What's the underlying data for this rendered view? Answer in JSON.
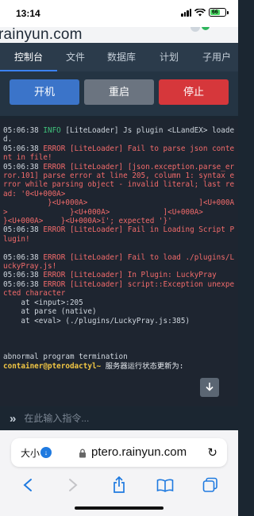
{
  "status_bar": {
    "time": "13:14",
    "battery": "66"
  },
  "header": {
    "brand": "rainyun.com"
  },
  "tabs": [
    "控制台",
    "文件",
    "数据库",
    "计划",
    "子用户"
  ],
  "controls": {
    "start": "开机",
    "restart": "重启",
    "stop": "停止"
  },
  "console": {
    "lines": [
      {
        "ts": "05:06:38 ",
        "level": "INFO",
        "msg": " [LiteLoader] Js plugin <LLandEX> loaded.",
        "type": "info"
      },
      {
        "ts": "05:06:38 ",
        "level": "ERROR",
        "msg": " [LiteLoader] Fail to parse json content in file!",
        "type": "error"
      },
      {
        "ts": "05:06:38 ",
        "level": "ERROR",
        "msg": " [LiteLoader] [json.exception.parse_error.101] parse error at line 205, column 1: syntax error while parsing object - invalid literal; last read: '0<U+000A>",
        "type": "error"
      },
      {
        "text": "          }<U+000A>                         ]<U+000A>              }<U+000A>            ]<U+000A>        }<U+000A>    }<U+000A>ï'; expected '}'",
        "type": "cont"
      },
      {
        "ts": "05:06:38 ",
        "level": "ERROR",
        "msg": " [LiteLoader] Fail in Loading Script Plugin!",
        "type": "error"
      },
      {
        "type": "blank"
      },
      {
        "ts": "05:06:38 ",
        "level": "ERROR",
        "msg": " [LiteLoader] Fail to load ./plugins/LuckyPray.js!",
        "type": "error"
      },
      {
        "ts": "05:06:38 ",
        "level": "ERROR",
        "msg": " [LiteLoader] In Plugin: LuckyPray",
        "type": "error"
      },
      {
        "ts": "05:06:38 ",
        "level": "ERROR",
        "msg": " [LiteLoader] script::Exception unexpected character",
        "type": "error"
      },
      {
        "text": "    at <input>:205",
        "type": "plain"
      },
      {
        "text": "    at parse (native)",
        "type": "plain"
      },
      {
        "text": "    at <eval> (./plugins/LuckyPray.js:385)",
        "type": "plain"
      },
      {
        "type": "blank"
      },
      {
        "type": "blank"
      },
      {
        "type": "blank"
      },
      {
        "text": "abnormal program termination",
        "type": "plain"
      }
    ],
    "prompt_user": "container@pterodactyl~",
    "prompt_status": " 服务器运行状态更新为:"
  },
  "command": {
    "placeholder": "在此输入指令..."
  },
  "safari": {
    "size_label": "大小",
    "url": "ptero.rainyun.com"
  }
}
